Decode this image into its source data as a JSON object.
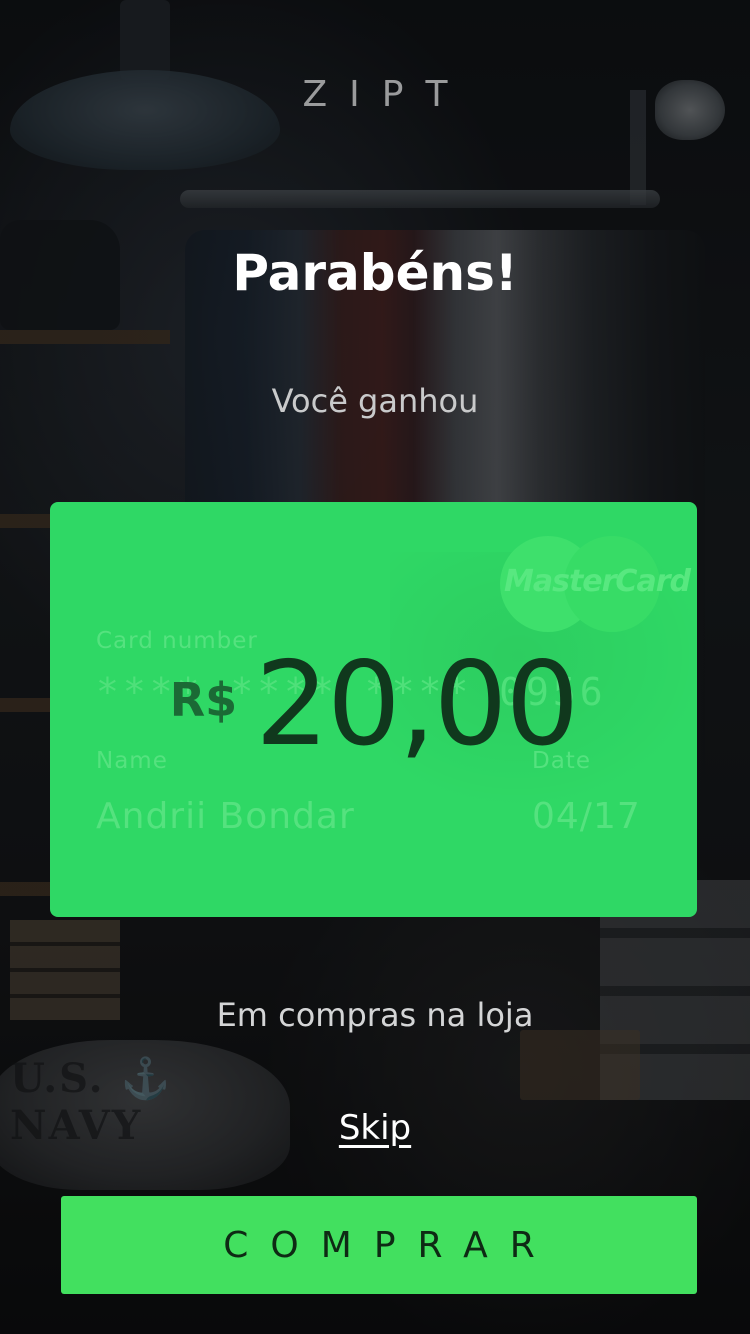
{
  "brand": "ZIPT",
  "title": "Parabéns!",
  "subtitle": "Você ganhou",
  "card": {
    "logo_text": "MasterCard",
    "number_label": "Card number",
    "number": "**** **** **** 0956",
    "name_label": "Name",
    "name": "Andrii Bondar",
    "date_label": "Date",
    "date": "04/17"
  },
  "reward": {
    "currency": "R$",
    "amount": "20,00"
  },
  "note": "Em compras na loja",
  "skip_label": "Skip",
  "buy_label": "COMPRAR",
  "background_scene": {
    "sack_text": "U.S. ⚓ NAVY"
  },
  "colors": {
    "accent": "#42e05f",
    "card": "#2fd865",
    "amount_text": "#10381d"
  }
}
